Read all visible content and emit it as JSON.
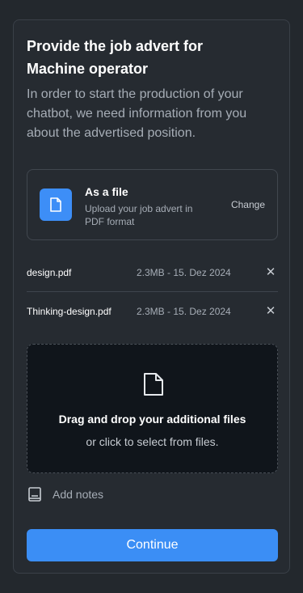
{
  "header": {
    "title_line1": "Provide the job advert for",
    "title_line2": "Machine operator",
    "subtitle": "In order to start the production of your chatbot, we need information from you about the advertised position."
  },
  "source": {
    "title": "As a file",
    "description": "Upload your job advert in PDF format",
    "change_label": "Change",
    "icon": "document-icon"
  },
  "files": [
    {
      "name": "design.pdf",
      "meta": "2.3MB - 15. Dez 2024",
      "remove_label": "✕"
    },
    {
      "name": "Thinking-design.pdf",
      "meta": "2.3MB - 15. Dez 2024",
      "remove_label": "✕"
    }
  ],
  "dropzone": {
    "title": "Drag and drop your additional files",
    "subtitle": "or click to select from files.",
    "icon": "file-icon"
  },
  "notes": {
    "label": "Add notes",
    "icon": "notebook-icon"
  },
  "actions": {
    "continue_label": "Continue"
  },
  "colors": {
    "accent": "#3b8ef5",
    "background": "#23282d",
    "card": "#262b31",
    "dropzone": "#10151b",
    "muted_text": "#a6adb6"
  }
}
